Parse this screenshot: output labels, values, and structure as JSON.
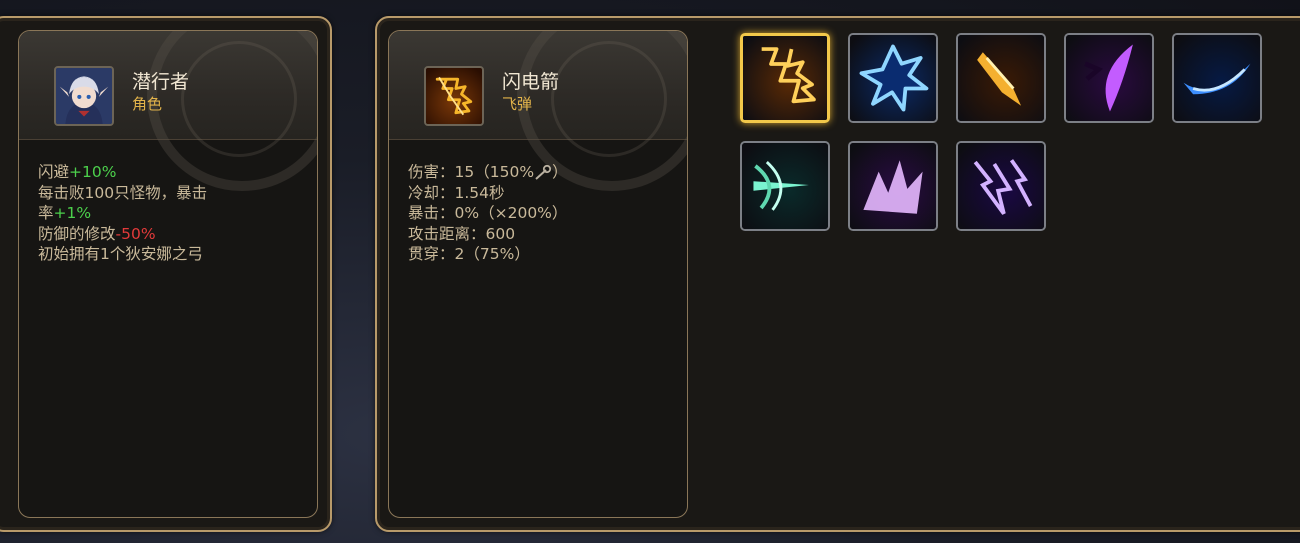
{
  "character": {
    "name": "潜行者",
    "type": "角色",
    "stats": [
      {
        "parts": [
          {
            "text": "闪避",
            "color": "normal"
          },
          {
            "text": "+10%",
            "color": "green"
          }
        ]
      },
      {
        "parts": [
          {
            "text": "每击败100只怪物，暴击",
            "color": "normal"
          }
        ]
      },
      {
        "parts": [
          {
            "text": "率",
            "color": "normal"
          },
          {
            "text": "+1%",
            "color": "green"
          }
        ]
      },
      {
        "parts": [
          {
            "text": "防御的修改",
            "color": "normal"
          },
          {
            "text": "-50%",
            "color": "red"
          }
        ]
      },
      {
        "parts": [
          {
            "text": "初始拥有1个狄安娜之弓",
            "color": "normal"
          }
        ]
      }
    ]
  },
  "weapon": {
    "name": "闪电箭",
    "type": "飞弹",
    "stats": [
      {
        "label": "伤害",
        "value_prefix": "15（150%",
        "value_suffix": "）",
        "icon": "wand-icon"
      },
      {
        "label": "冷却",
        "value_prefix": "1.54秒",
        "value_suffix": ""
      },
      {
        "label": "暴击",
        "value_prefix": "0%（×200%）",
        "value_suffix": ""
      },
      {
        "label": "攻击距离",
        "value_prefix": "600",
        "value_suffix": ""
      },
      {
        "label": "贯穿",
        "value_prefix": "2（75%）",
        "value_suffix": ""
      }
    ],
    "separator": "："
  },
  "skills": [
    {
      "icon": "lightning-arrow-icon",
      "selected": true,
      "colors": [
        "#5a2a05",
        "#f2a21b"
      ]
    },
    {
      "icon": "blue-lightning-burst-icon",
      "selected": false,
      "colors": [
        "#0b2a66",
        "#5ab8ff"
      ]
    },
    {
      "icon": "golden-arrow-icon",
      "selected": false,
      "colors": [
        "#3a1a05",
        "#f0a030"
      ]
    },
    {
      "icon": "purple-slash-icon",
      "selected": false,
      "colors": [
        "#2a0a40",
        "#c04cff"
      ]
    },
    {
      "icon": "blue-wave-icon",
      "selected": false,
      "colors": [
        "#061a44",
        "#3a8cff"
      ]
    },
    {
      "icon": "green-arrow-icon",
      "selected": false,
      "colors": [
        "#0a2a2a",
        "#5ff0c0"
      ]
    },
    {
      "icon": "violet-burst-icon",
      "selected": false,
      "colors": [
        "#2a0c44",
        "#d99aff"
      ]
    },
    {
      "icon": "violet-lightning-icon",
      "selected": false,
      "colors": [
        "#1a0844",
        "#a870ff"
      ]
    }
  ]
}
